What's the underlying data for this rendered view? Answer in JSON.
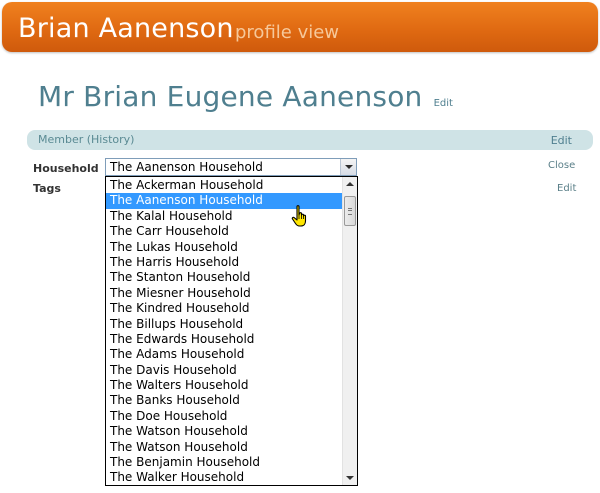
{
  "banner": {
    "name": "Brian Aanenson",
    "subtitle": "profile view"
  },
  "title": {
    "text": "Mr Brian Eugene Aanenson",
    "edit_label": "Edit"
  },
  "member_bar": {
    "label": "Member (History)",
    "edit_label": "Edit"
  },
  "household": {
    "label": "Household",
    "close_label": "Close"
  },
  "tags": {
    "label": "Tags",
    "edit_label": "Edit"
  },
  "select": {
    "selected_value": "The Aanenson Household",
    "options": [
      "The Ackerman Household",
      "The Aanenson Household",
      "The Kalal Household",
      "The Carr Household",
      "The Lukas Household",
      "The Harris Household",
      "The Stanton Household",
      "The Miesner Household",
      "The Kindred Household",
      "The Billups Household",
      "The Edwards Household",
      "The Adams Household",
      "The Davis Household",
      "The Walters Household",
      "The Banks Household",
      "The Doe Household",
      "The Watson Household",
      "The Watson Household",
      "The Benjamin Household",
      "The Walker Household"
    ],
    "highlighted_index": 1
  },
  "colors": {
    "banner": "#e06a12",
    "accent_teal": "#4f7f8f",
    "bar": "#cfe3e6",
    "selection": "#3399ff"
  },
  "icons": {
    "cursor": "hand-pointer-icon"
  }
}
